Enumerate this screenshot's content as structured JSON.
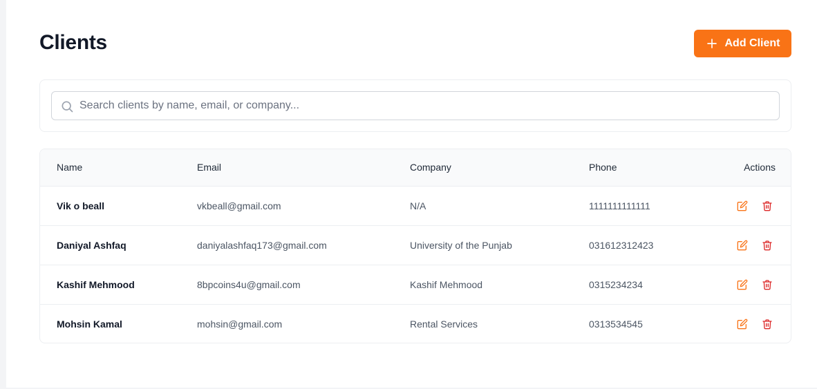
{
  "header": {
    "title": "Clients",
    "add_button_label": "Add Client",
    "add_button_icon": "plus-icon"
  },
  "search": {
    "placeholder": "Search clients by name, email, or company...",
    "value": "",
    "icon": "search-icon"
  },
  "table": {
    "columns": [
      "Name",
      "Email",
      "Company",
      "Phone",
      "Actions"
    ],
    "rows": [
      {
        "name": "Vik o beall",
        "email": "vkbeall@gmail.com",
        "company": "N/A",
        "phone": "1111111111111"
      },
      {
        "name": "Daniyal Ashfaq",
        "email": "daniyalashfaq173@gmail.com",
        "company": "University of the Punjab",
        "phone": "031612312423"
      },
      {
        "name": "Kashif Mehmood",
        "email": "8bpcoins4u@gmail.com",
        "company": "Kashif Mehmood",
        "phone": "0315234234"
      },
      {
        "name": "Mohsin Kamal",
        "email": "mohsin@gmail.com",
        "company": "Rental Services",
        "phone": "0313534545"
      }
    ],
    "row_actions": [
      "edit-icon",
      "trash-icon"
    ]
  },
  "colors": {
    "accent": "#f97316",
    "danger": "#dc2626",
    "edit": "#f97316"
  }
}
